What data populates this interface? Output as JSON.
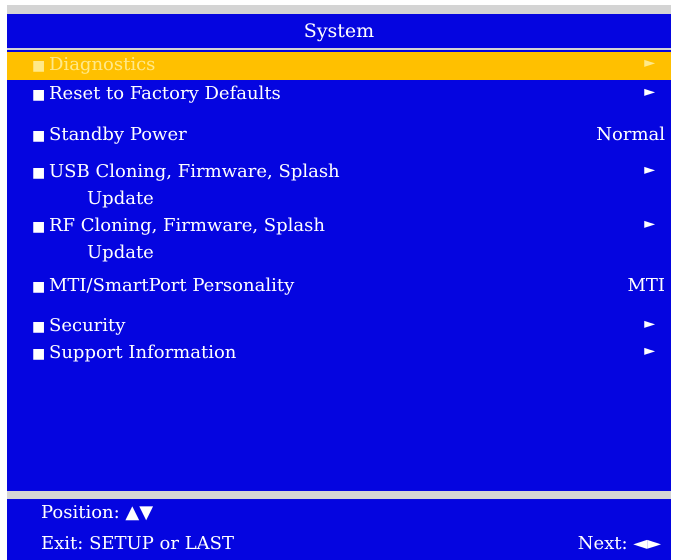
{
  "title": "System",
  "menu": {
    "items": [
      {
        "label": "Diagnostics",
        "arrow": "►",
        "selected": true
      },
      {
        "label": "Reset to Factory Defaults",
        "arrow": "►"
      },
      {
        "label": "Standby Power",
        "value": "Normal"
      },
      {
        "label": "USB Cloning, Firmware, Splash",
        "label2": "Update",
        "arrow": "►"
      },
      {
        "label": "RF Cloning, Firmware, Splash",
        "label2": "Update",
        "arrow": "►"
      },
      {
        "label": "MTI/SmartPort Personality",
        "value": "MTI"
      },
      {
        "label": "Security",
        "arrow": "►"
      },
      {
        "label": "Support Information",
        "arrow": "►"
      }
    ],
    "bullet": "■"
  },
  "footer": {
    "position": "Position: ▲▼",
    "exit": "Exit: SETUP or LAST",
    "next": "Next: ◄►"
  },
  "colors": {
    "background": "#0505e0",
    "highlight": "#ffc000",
    "text": "#ffffff"
  }
}
